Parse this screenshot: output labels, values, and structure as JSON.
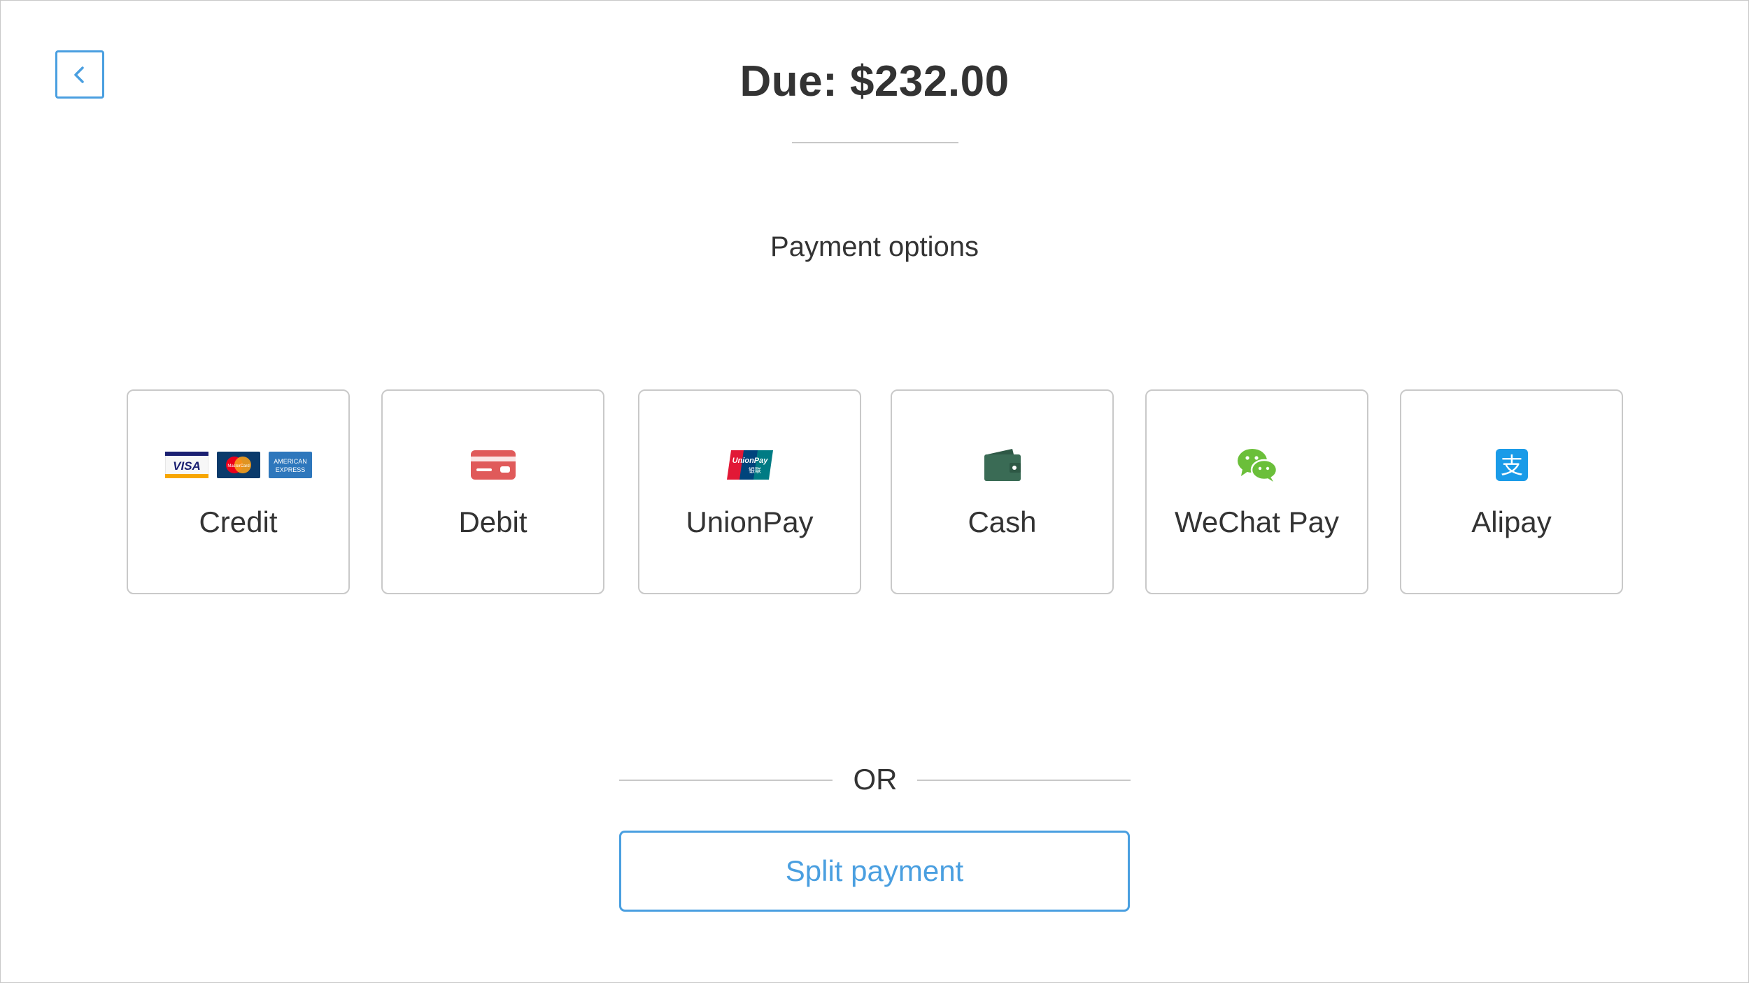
{
  "header": {
    "back_icon": "chevron-left-icon",
    "due_label": "Due: $232.00"
  },
  "payment": {
    "heading": "Payment options",
    "options": [
      {
        "label": "Credit",
        "icons": [
          "visa-icon",
          "mastercard-icon",
          "amex-icon"
        ]
      },
      {
        "label": "Debit",
        "icons": [
          "debit-card-icon"
        ]
      },
      {
        "label": "UnionPay",
        "icons": [
          "unionpay-icon"
        ]
      },
      {
        "label": "Cash",
        "icons": [
          "wallet-icon"
        ]
      },
      {
        "label": "WeChat Pay",
        "icons": [
          "wechat-icon"
        ]
      },
      {
        "label": "Alipay",
        "icons": [
          "alipay-icon"
        ]
      }
    ]
  },
  "divider": {
    "or_label": "OR"
  },
  "split": {
    "button_label": "Split payment"
  },
  "colors": {
    "accent": "#4a9fe0",
    "text": "#333333",
    "border": "#c9c9c9",
    "debit": "#e05a5a",
    "cash": "#3a6b55",
    "wechat": "#6bbf3a",
    "alipay": "#1a9be8"
  }
}
